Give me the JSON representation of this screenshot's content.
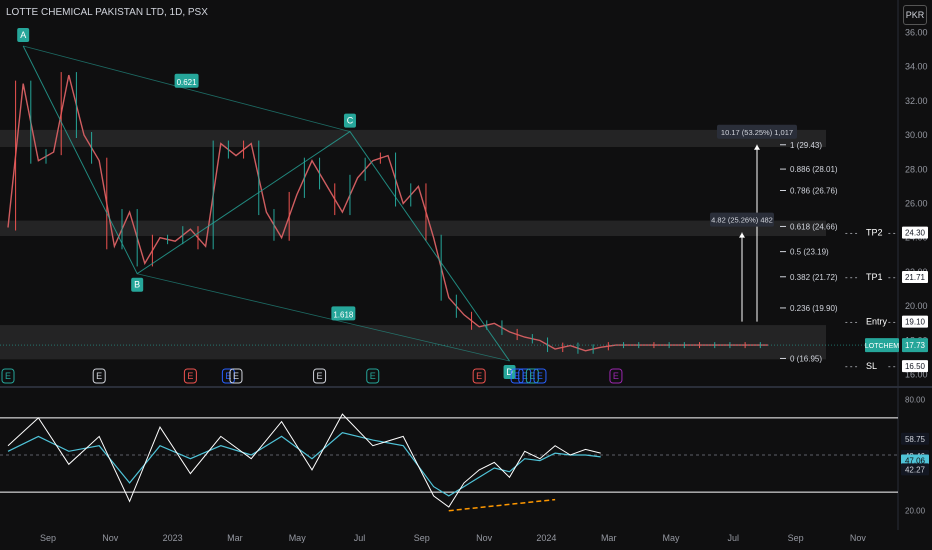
{
  "header": {
    "title": "LOTTE CHEMICAL PAKISTAN LTD, 1D, PSX",
    "currency_button": "PKR"
  },
  "chart_data": {
    "type": "line",
    "title": "LOTTE CHEMICAL PAKISTAN LTD, 1D, PSX",
    "price_axis": {
      "ticks": [
        16.0,
        18.0,
        20.0,
        22.0,
        24.0,
        26.0,
        28.0,
        30.0,
        32.0,
        34.0,
        36.0
      ],
      "ylim": [
        15.4,
        36.6
      ]
    },
    "time_axis": [
      "Sep",
      "Nov",
      "2023",
      "Mar",
      "May",
      "Jul",
      "Sep",
      "Nov",
      "2024",
      "Mar",
      "May",
      "Jul",
      "Sep",
      "Nov"
    ],
    "price_series": {
      "name": "LOTCHEM",
      "x": [
        0,
        2,
        4,
        6,
        8,
        10,
        12,
        14,
        16,
        18,
        20,
        22,
        24,
        26,
        28,
        30,
        32,
        34,
        36,
        38,
        40,
        42,
        44,
        46,
        48,
        50,
        52,
        54,
        56,
        58,
        60,
        62,
        64,
        66,
        68,
        70,
        72,
        74,
        76,
        78,
        80,
        82,
        84,
        86,
        88,
        90,
        92,
        94,
        96,
        98,
        100
      ],
      "y": [
        24.6,
        33.0,
        28.5,
        29.0,
        33.5,
        30.0,
        28.5,
        23.5,
        25.5,
        22.5,
        24.0,
        23.8,
        24.5,
        23.5,
        29.5,
        28.8,
        29.5,
        25.5,
        24.0,
        26.5,
        28.5,
        27.0,
        25.5,
        27.5,
        28.5,
        28.8,
        26.0,
        27.0,
        24.0,
        20.5,
        19.5,
        18.8,
        19.0,
        18.5,
        18.2,
        18.0,
        17.5,
        17.7,
        17.4,
        17.6,
        17.73,
        17.73,
        17.73,
        17.73,
        17.73,
        17.73,
        17.73,
        17.73,
        17.73,
        17.73,
        17.73
      ]
    },
    "zones": [
      {
        "from": 29.3,
        "to": 30.3
      },
      {
        "from": 24.1,
        "to": 25.0
      },
      {
        "from": 16.9,
        "to": 18.9
      }
    ],
    "pattern_points": [
      {
        "label": "A",
        "x": 2,
        "price": 35.2
      },
      {
        "label": "B",
        "x": 17,
        "price": 21.9
      },
      {
        "label": "C",
        "x": 45,
        "price": 30.2
      },
      {
        "label": "D",
        "x": 66,
        "price": 16.8
      }
    ],
    "pattern_ratios": [
      "0.621",
      "1.618"
    ],
    "fib_levels": [
      {
        "label": "1 (29.43)",
        "price": 29.43
      },
      {
        "label": "0.886 (28.01)",
        "price": 28.01
      },
      {
        "label": "0.786 (26.76)",
        "price": 26.76
      },
      {
        "label": "0.618 (24.66)",
        "price": 24.66
      },
      {
        "label": "0.5 (23.19)",
        "price": 23.19
      },
      {
        "label": "0.382 (21.72)",
        "price": 21.72
      },
      {
        "label": "0.236 (19.90)",
        "price": 19.9
      },
      {
        "label": "0 (16.95)",
        "price": 16.95
      }
    ],
    "measurements": [
      {
        "label": "10.17 (53.25%) 1,017",
        "from": 19.1,
        "to": 29.43
      },
      {
        "label": "4.82 (25.26%) 482",
        "from": 19.1,
        "to": 24.3
      }
    ],
    "trade_levels": [
      {
        "label": "TP2",
        "price": 24.3,
        "value": "24.30"
      },
      {
        "label": "TP1",
        "price": 21.71,
        "value": "21.71"
      },
      {
        "label": "Entry",
        "price": 19.1,
        "value": "19.10"
      },
      {
        "label": "SL",
        "price": 16.5,
        "value": "16.50"
      }
    ],
    "last_price": {
      "symbol": "LOTCHEM",
      "value": "17.73",
      "price": 17.73
    },
    "event_markers": [
      {
        "text": "E",
        "x": 0,
        "color": "#26a69a"
      },
      {
        "text": "E",
        "x": 12,
        "color": "#d1d4dc"
      },
      {
        "text": "E",
        "x": 24,
        "color": "#ef5350"
      },
      {
        "text": "E",
        "x": 29,
        "color": "#2962ff"
      },
      {
        "text": "E",
        "x": 30,
        "color": "#d1d4dc"
      },
      {
        "text": "E",
        "x": 41,
        "color": "#d1d4dc"
      },
      {
        "text": "E",
        "x": 48,
        "color": "#26a69a"
      },
      {
        "text": "E",
        "x": 62,
        "color": "#ef5350"
      },
      {
        "text": "E",
        "x": 67,
        "color": "#2962ff"
      },
      {
        "text": "E",
        "x": 68,
        "color": "#2962ff"
      },
      {
        "text": "E",
        "x": 69,
        "color": "#26a69a"
      },
      {
        "text": "E",
        "x": 70,
        "color": "#2962ff"
      },
      {
        "text": "E",
        "x": 80,
        "color": "#9c27b0"
      }
    ],
    "oscillator": {
      "ticks": [
        "80.00",
        "20.00"
      ],
      "levels": [
        {
          "value": "58.75",
          "price": 58.75
        },
        {
          "value": "49.46",
          "price": 49.46
        },
        {
          "value": "47.06",
          "price": 47.06,
          "highlight": true
        },
        {
          "value": "42.27",
          "price": 42.27
        }
      ],
      "bands": [
        70,
        30
      ],
      "ylim": [
        15,
        85
      ],
      "x": [
        0,
        4,
        8,
        12,
        16,
        20,
        24,
        28,
        32,
        36,
        40,
        44,
        48,
        52,
        56,
        58,
        60,
        62,
        64,
        66,
        68,
        70,
        72,
        74,
        76,
        78
      ],
      "rsi": [
        55,
        70,
        45,
        60,
        25,
        65,
        40,
        60,
        48,
        68,
        42,
        72,
        55,
        60,
        28,
        22,
        35,
        42,
        46,
        38,
        52,
        48,
        55,
        50,
        53,
        51
      ],
      "ma": [
        52,
        60,
        52,
        55,
        35,
        55,
        48,
        55,
        50,
        60,
        48,
        62,
        58,
        55,
        33,
        28,
        33,
        38,
        43,
        41,
        48,
        47,
        51,
        50,
        50,
        49
      ]
    }
  }
}
